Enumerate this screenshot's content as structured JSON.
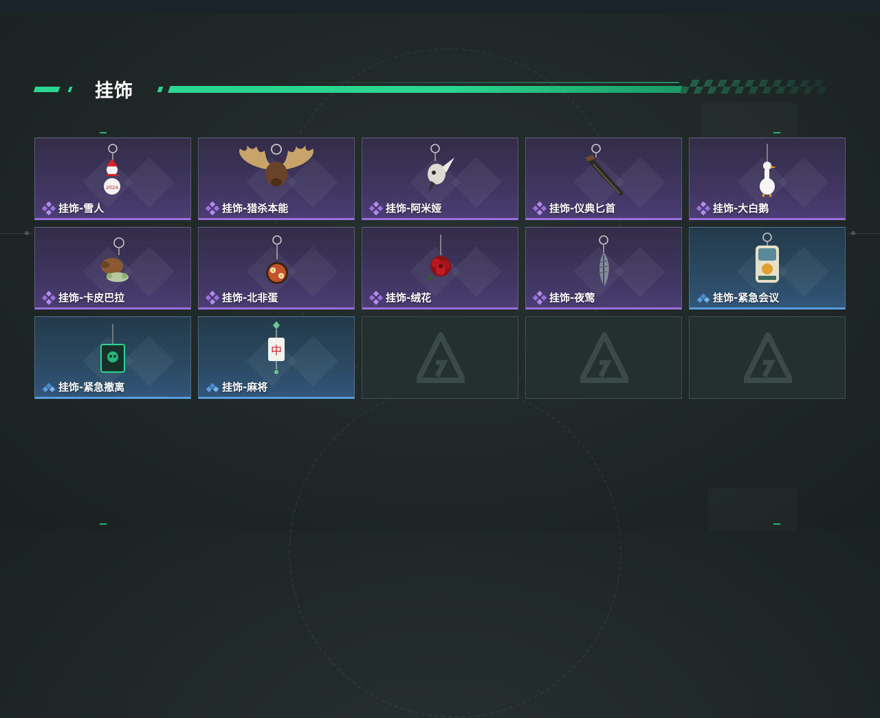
{
  "page": {
    "title": "挂饰"
  },
  "items": [
    {
      "name": "挂饰-雪人",
      "rarity": "epic",
      "icon": "snowman-charm-icon"
    },
    {
      "name": "挂饰-猎杀本能",
      "rarity": "epic",
      "icon": "moose-antlers-charm-icon"
    },
    {
      "name": "挂饰-阿米娅",
      "rarity": "epic",
      "icon": "amiya-charm-icon"
    },
    {
      "name": "挂饰-仪典匕首",
      "rarity": "epic",
      "icon": "ritual-dagger-charm-icon"
    },
    {
      "name": "挂饰-大白鹅",
      "rarity": "epic",
      "icon": "white-goose-charm-icon"
    },
    {
      "name": "挂饰-卡皮巴拉",
      "rarity": "epic",
      "icon": "capybara-charm-icon"
    },
    {
      "name": "挂饰-北非蛋",
      "rarity": "epic",
      "icon": "shakshuka-charm-icon"
    },
    {
      "name": "挂饰-绒花",
      "rarity": "epic",
      "icon": "velvet-flower-charm-icon"
    },
    {
      "name": "挂饰-夜莺",
      "rarity": "epic",
      "icon": "nightingale-feather-charm-icon"
    },
    {
      "name": "挂饰-紧急会议",
      "rarity": "rare",
      "icon": "emergency-meeting-charm-icon"
    },
    {
      "name": "挂饰-紧急撤离",
      "rarity": "rare",
      "icon": "emergency-evacuation-charm-icon"
    },
    {
      "name": "挂饰-麻将",
      "rarity": "rare",
      "icon": "mahjong-tile-charm-icon"
    }
  ],
  "empty_slot_icon": "game-logo-icon",
  "colors": {
    "accent": "#2bd790",
    "epic": "#9b6fe0",
    "rare": "#5b9ee0",
    "empty": "#243030"
  }
}
